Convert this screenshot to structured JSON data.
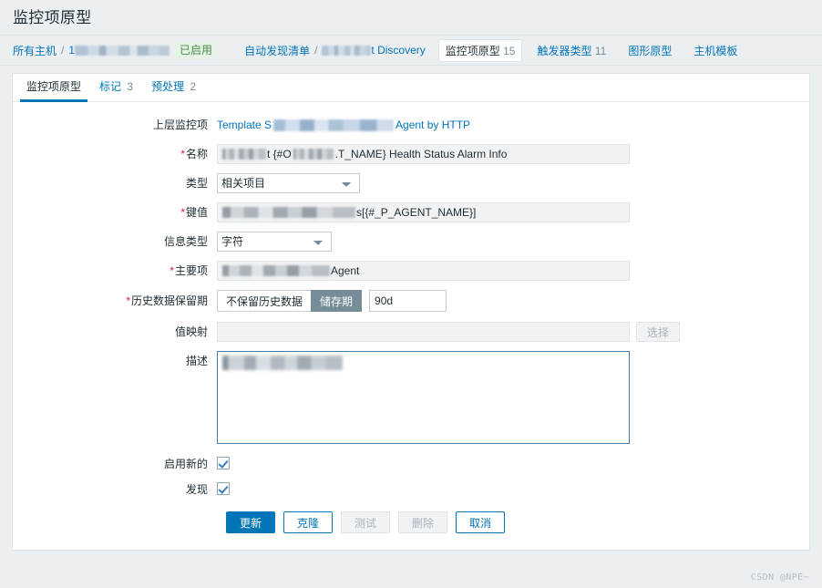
{
  "page": {
    "title": "监控项原型",
    "watermark": "CSDN @NPE~"
  },
  "breadcrumb": {
    "all_hosts": "所有主机",
    "host_prefix": "1",
    "status_badge": "已启用",
    "discovery_list": "自动发现清单",
    "discovery_name_suffix": "t Discovery",
    "separator": "/",
    "tabs": [
      {
        "label": "监控项原型",
        "count": "15",
        "active": true
      },
      {
        "label": "触发器类型",
        "count": "11",
        "active": false
      },
      {
        "label": "图形原型",
        "count": "",
        "active": false
      },
      {
        "label": "主机模板",
        "count": "",
        "active": false
      }
    ]
  },
  "inner_tabs": [
    {
      "label": "监控项原型",
      "count": "",
      "active": true
    },
    {
      "label": "标记",
      "count": "3",
      "active": false
    },
    {
      "label": "预处理",
      "count": "2",
      "active": false
    }
  ],
  "form": {
    "parent_item": {
      "label": "上层监控项",
      "prefix": "Template S",
      "suffix": "Agent by HTTP"
    },
    "name": {
      "label": "名称",
      "required": true,
      "prefix": "t {#O",
      "suffix": ".T_NAME}  Health Status Alarm Info"
    },
    "type": {
      "label": "类型",
      "required": false,
      "value": "相关项目",
      "options": [
        "相关项目"
      ]
    },
    "key": {
      "label": "键值",
      "required": true,
      "suffix": "s[{#_P_AGENT_NAME}]"
    },
    "value_type": {
      "label": "信息类型",
      "required": false,
      "value": "字符",
      "options": [
        "字符"
      ]
    },
    "master_item": {
      "label": "主要项",
      "required": true,
      "suffix": "Agent"
    },
    "history": {
      "label": "历史数据保留期",
      "required": true,
      "option_off": "不保留历史数据",
      "option_on": "储存期",
      "selected": "储存期",
      "value": "90d"
    },
    "value_map": {
      "label": "值映射",
      "required": false,
      "value": "",
      "select_button": "选择"
    },
    "description": {
      "label": "描述",
      "required": false,
      "value": ""
    },
    "enabled": {
      "label": "启用新的",
      "checked": true
    },
    "discover": {
      "label": "发现",
      "checked": true
    }
  },
  "buttons": [
    {
      "label": "更新",
      "style": "primary",
      "disabled": false
    },
    {
      "label": "克隆",
      "style": "secondary",
      "disabled": false
    },
    {
      "label": "测试",
      "style": "disabled",
      "disabled": true
    },
    {
      "label": "删除",
      "style": "disabled",
      "disabled": true
    },
    {
      "label": "取消",
      "style": "secondary",
      "disabled": false
    }
  ],
  "colors": {
    "accent": "#0275b8",
    "page_bg": "#eceff2",
    "card_bg": "#ffffff",
    "border": "#dfe4e7",
    "required": "#d14",
    "status_green_text": "#4a8c4a",
    "status_green_bg": "#e6f2e6",
    "segment_on_bg": "#768d99"
  }
}
